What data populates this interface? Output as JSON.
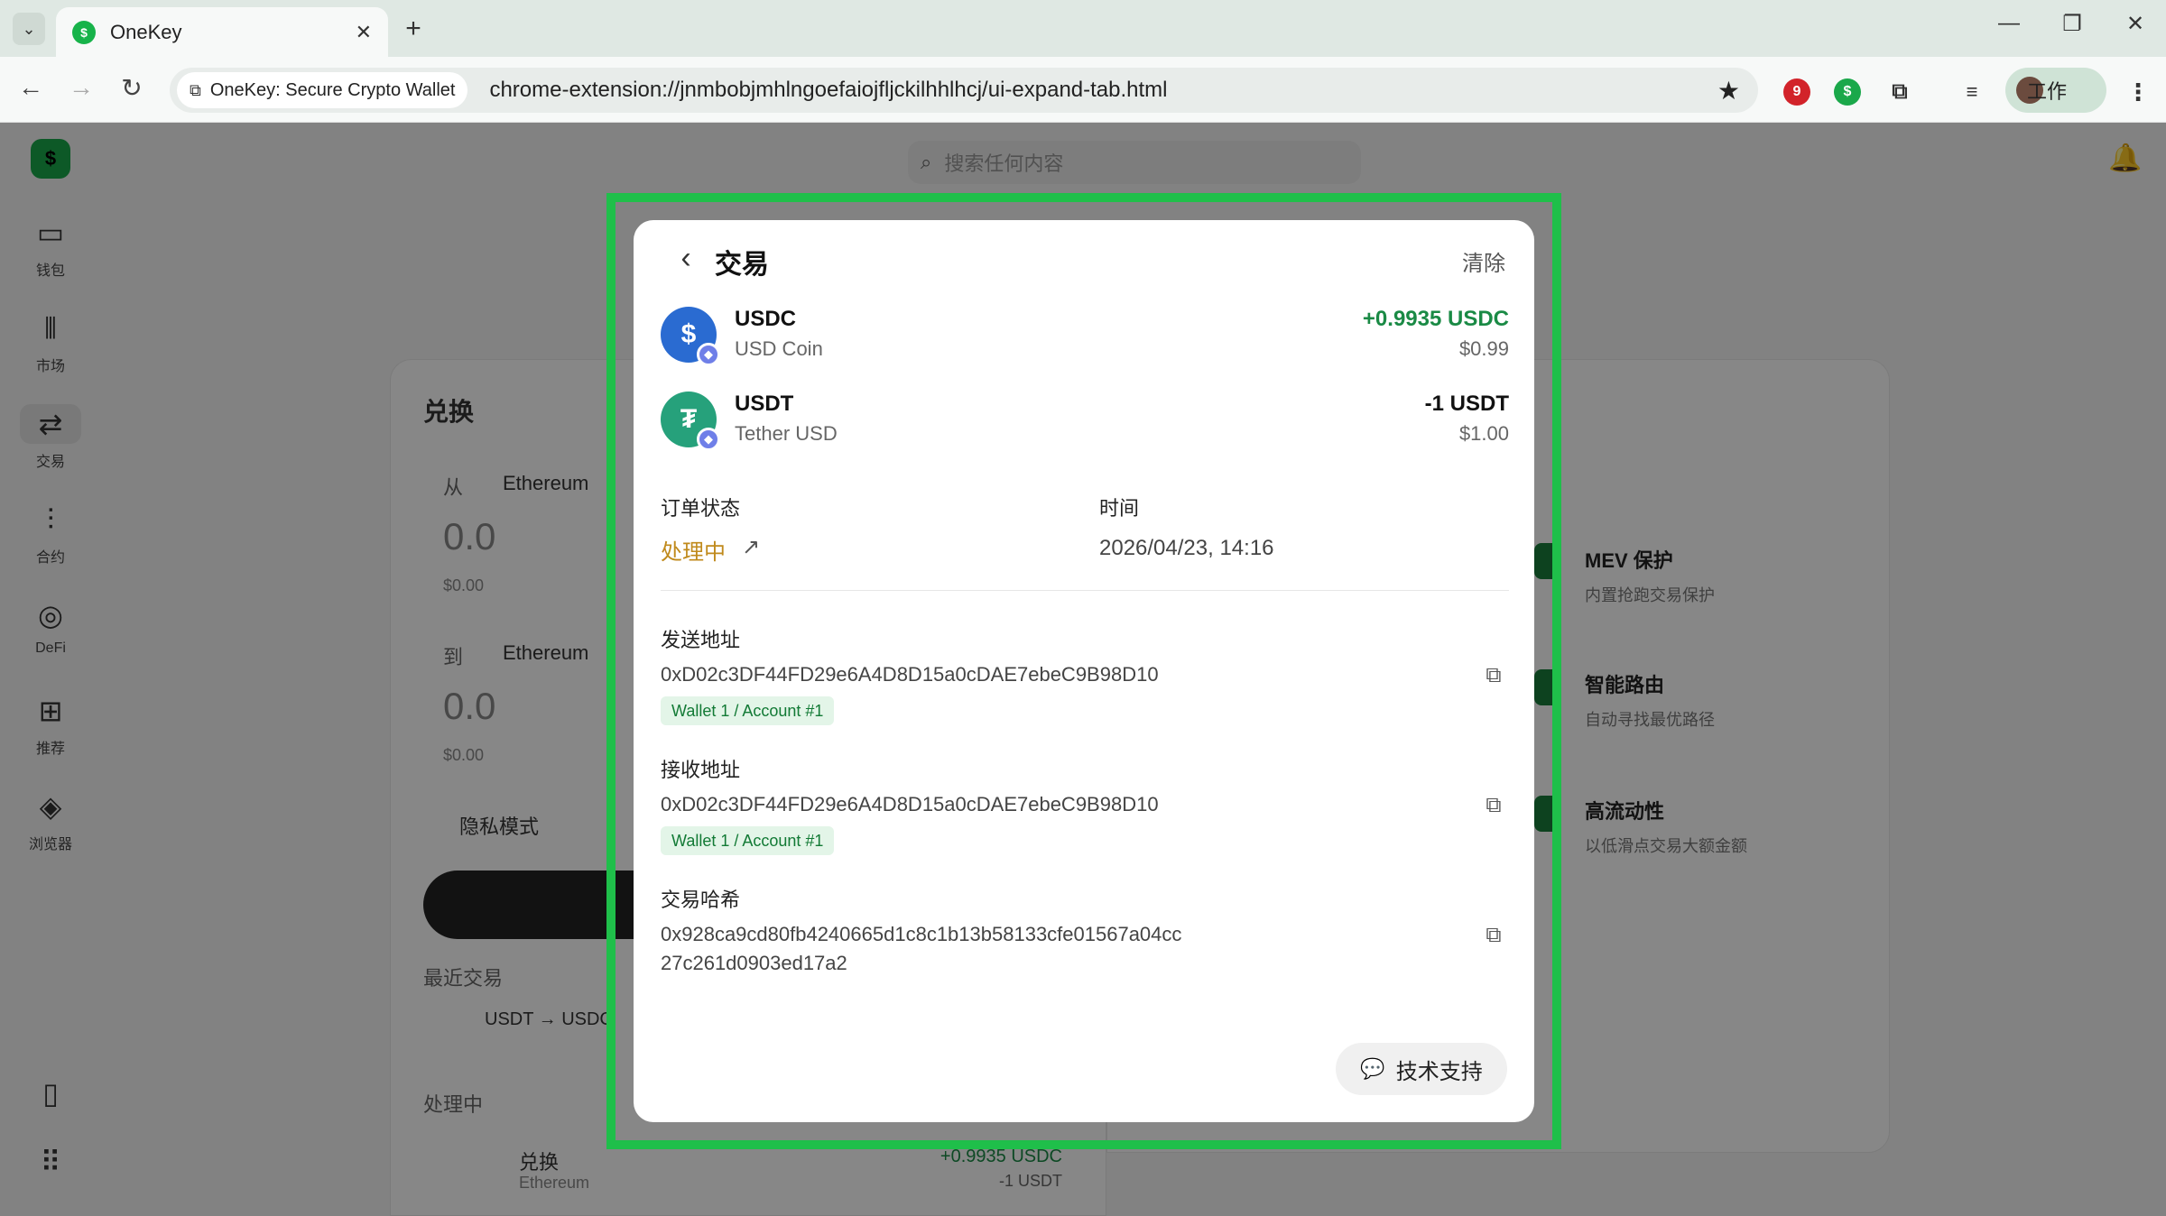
{
  "browser": {
    "tab_title": "OneKey",
    "site_chip": "OneKey: Secure Crypto Wallet",
    "url": "chrome-extension://jnmbobjmhlngoefaiojfljckilhhlhcj/ui-expand-tab.html",
    "profile_label": "工作"
  },
  "app": {
    "search_placeholder": "搜索任何内容",
    "nav": [
      {
        "label": "钱包"
      },
      {
        "label": "市场"
      },
      {
        "label": "交易"
      },
      {
        "label": "合约"
      },
      {
        "label": "DeFi"
      },
      {
        "label": "推荐"
      },
      {
        "label": "浏览器"
      }
    ],
    "swap": {
      "title": "兑换",
      "from_label": "从",
      "from_chain": "Ethereum",
      "from_amount": "0.0",
      "from_fiat": "$0.00",
      "to_label": "到",
      "to_chain": "Ethereum",
      "to_amount": "0.0",
      "to_fiat": "$0.00",
      "privacy_label": "隐私模式",
      "recent_label": "最近交易",
      "recent_chip": "USDT → USDC",
      "pending_label": "处理中",
      "pending_item_title": "兑换",
      "pending_item_chain": "Ethereum",
      "pending_item_amt": "+0.9935 USDC",
      "pending_item_sub": "-1 USDT"
    },
    "features": [
      {
        "title": "MEV 保护",
        "desc": "内置抢跑交易保护"
      },
      {
        "title": "智能路由",
        "desc": "自动寻找最优路径"
      },
      {
        "title": "高流动性",
        "desc": "以低滑点交易大额金额"
      }
    ]
  },
  "modal": {
    "title": "交易",
    "clear_label": "清除",
    "assets": [
      {
        "symbol": "USDC",
        "name": "USD Coin",
        "amount": "+0.9935 USDC",
        "fiat": "$0.99",
        "amount_color": "#1a8a45",
        "coin_color": "#2a6bd1"
      },
      {
        "symbol": "USDT",
        "name": "Tether USD",
        "amount": "-1 USDT",
        "fiat": "$1.00",
        "amount_color": "#111111",
        "coin_color": "#26a17b"
      }
    ],
    "order_status_label": "订单状态",
    "order_status_value": "处理中",
    "time_label": "时间",
    "time_value": "2026/04/23, 14:16",
    "sender_label": "发送地址",
    "sender_address": "0xD02c3DF44FD29e6A4D8D15a0cDAE7ebeC9B98D10",
    "sender_tag": "Wallet 1 / Account #1",
    "receiver_label": "接收地址",
    "receiver_address": "0xD02c3DF44FD29e6A4D8D15a0cDAE7ebeC9B98D10",
    "receiver_tag": "Wallet 1 / Account #1",
    "hash_label": "交易哈希",
    "hash_line1": "0x928ca9cd80fb4240665d1c8c1b13b58133cfe01567a04cc",
    "hash_line2": "27c261d0903ed17a2",
    "support_label": "技术支持"
  },
  "colors": {
    "highlight": "#1fbf4a",
    "status_pending": "#c08a1c",
    "positive": "#1a8a45"
  }
}
